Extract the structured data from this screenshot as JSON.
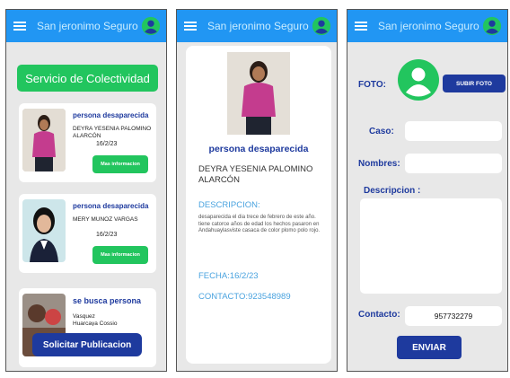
{
  "app": {
    "title": "San jeronimo Seguro"
  },
  "feed": {
    "service_button": "Servicio de Colectividad",
    "cards": [
      {
        "title": "persona desaparecida",
        "name": "DEYRA YESENIA PALOMINO ALARCÓN",
        "date": "16/2/23",
        "button": "Mas informacion"
      },
      {
        "title": "persona desaparecida",
        "name": "MERY MUÑOZ VARGAS",
        "date": "16/2/23",
        "button": "Mas informacion"
      },
      {
        "title": "se busca persona",
        "name": "Vasquez Huarcaya Cossio"
      }
    ],
    "request_button": "Solicitar Publicacion"
  },
  "detail": {
    "title": "persona desaparecida",
    "name": "DEYRA YESENIA PALOMINO ALARCÓN",
    "description_label": "DESCRIPCION:",
    "description": "desaparecida el dia trece de febrero de este año. tiene catorce años de edad los hechos pasaron en Andahuaylasviste casaca de color plomo polo rojo.",
    "date": "FECHA:16/2/23",
    "contact": "CONTACTO:923548989"
  },
  "form": {
    "photo_label": "FOTO:",
    "upload_button": "SUBIR FOTO",
    "case_label": "Caso:",
    "names_label": "Nombres:",
    "description_label": "Descripcion :",
    "contact_label": "Contacto:",
    "contact_value": "957732279",
    "send_button": "ENVIAR"
  },
  "colors": {
    "appbar": "#2196f3",
    "green": "#22c55e",
    "navy": "#1e3a9e",
    "background": "#e8e8e8"
  },
  "icons": [
    "menu-icon",
    "account-icon"
  ]
}
